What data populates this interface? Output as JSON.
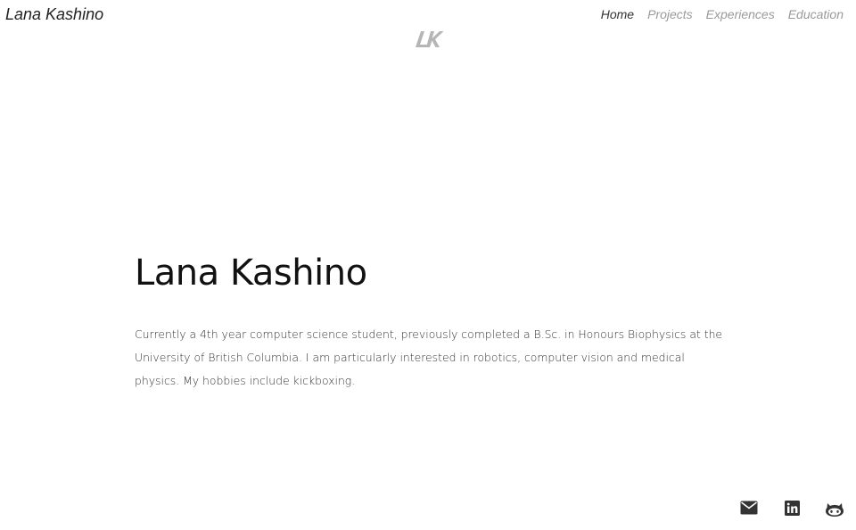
{
  "header": {
    "brand": "Lana Kashino",
    "nav": [
      {
        "label": "Home",
        "active": true
      },
      {
        "label": "Projects",
        "active": false
      },
      {
        "label": "Experiences",
        "active": false
      },
      {
        "label": "Education",
        "active": false
      }
    ],
    "logo_text": "LK"
  },
  "hero": {
    "title": "Lana Kashino",
    "description": "Currently a 4th year computer science student, previously completed a B.Sc. in Honours Biophysics at the University of British Columbia. I am particularly interested in robotics, computer vision and medical physics. My hobbies include kickboxing."
  },
  "social": {
    "icons": [
      "envelope-icon",
      "linkedin-icon",
      "github-icon"
    ],
    "icon_color": "#333333"
  },
  "colors": {
    "nav_inactive": "#9a9a9a",
    "nav_active": "#333333",
    "logo_gray": "#b5b5b5"
  }
}
